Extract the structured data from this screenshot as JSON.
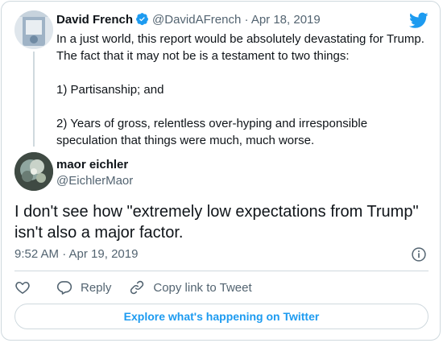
{
  "parent_tweet": {
    "author_name": "David French",
    "author_handle": "@DavidAFrench",
    "separator": "·",
    "date": "Apr 18, 2019",
    "lines": [
      "In a just world, this report would be absolutely devastating for Trump.",
      "The fact that it may not be is a testament to two things:",
      "1) Partisanship; and",
      "2) Years of gross, relentless over-hyping and irresponsible",
      "speculation that things were much, much worse."
    ]
  },
  "reply_tweet": {
    "author_name": "maor eichler",
    "author_handle": "@EichlerMaor",
    "text": "I don't see how \"extremely low expectations from Trump\" isn't also a major factor.",
    "timestamp": "9:52 AM · Apr 19, 2019"
  },
  "actions": {
    "reply_label": "Reply",
    "copy_link_label": "Copy link to Tweet"
  },
  "explore_label": "Explore what's happening on Twitter",
  "colors": {
    "twitter_blue": "#1d9bf0",
    "text_primary": "#0f1419",
    "text_muted": "#536471",
    "border": "#cfd9de"
  },
  "icons": [
    "verified-badge-icon",
    "twitter-bird-icon",
    "info-icon",
    "heart-icon",
    "reply-bubble-icon",
    "link-icon"
  ]
}
